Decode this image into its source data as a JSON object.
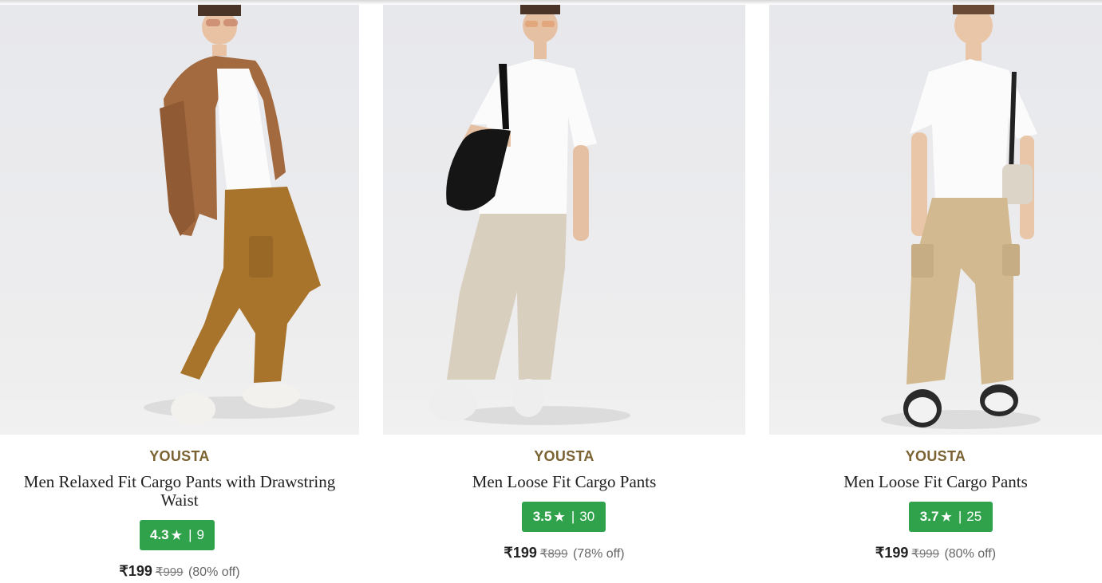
{
  "colors": {
    "brand": "#7a6232",
    "rating_bg": "#31a24c",
    "image_bg": "#ebebee"
  },
  "products": [
    {
      "brand": "YOUSTA",
      "title": "Men Relaxed Fit Cargo Pants with Drawstring Waist",
      "rating": "4.3",
      "star": "★",
      "separator": "|",
      "rating_count": "9",
      "price": "₹199",
      "mrp": "₹999",
      "discount": "(80% off)"
    },
    {
      "brand": "YOUSTA",
      "title": "Men Loose Fit Cargo Pants",
      "rating": "3.5",
      "star": "★",
      "separator": "|",
      "rating_count": "30",
      "price": "₹199",
      "mrp": "₹899",
      "discount": "(78% off)"
    },
    {
      "brand": "YOUSTA",
      "title": "Men Loose Fit Cargo Pants",
      "rating": "3.7",
      "star": "★",
      "separator": "|",
      "rating_count": "25",
      "price": "₹199",
      "mrp": "₹999",
      "discount": "(80% off)"
    }
  ]
}
